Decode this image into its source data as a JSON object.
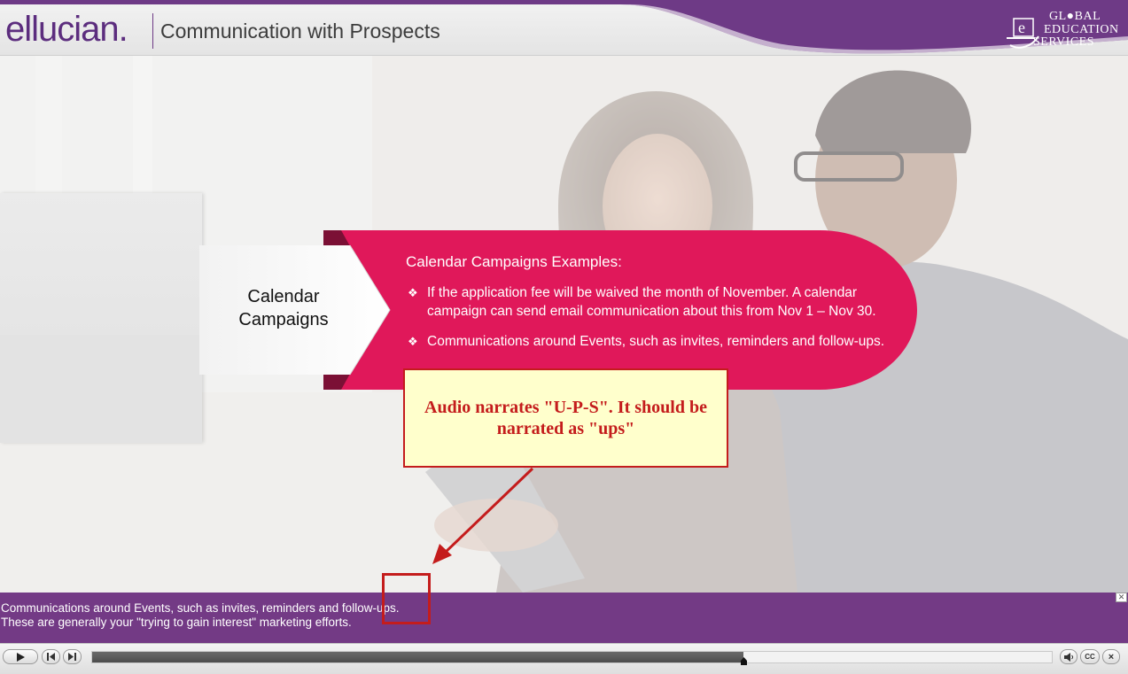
{
  "header": {
    "logo_text": "ellucian",
    "logo_dot": ".",
    "course_title": "Communication with Prospects",
    "brand_badge": {
      "line_1": "GL●BAL",
      "line_2": "EDUCATION",
      "line_3": "SERVICES",
      "emblem_letter": "e"
    }
  },
  "slide": {
    "callout_label": "Calendar Campaigns",
    "heading": "Calendar Campaigns Examples:",
    "bullets": [
      "If the application fee will be waived the month of November. A calendar campaign can send email communication about this from Nov 1 – Nov 30.",
      "Communications around Events, such as invites, reminders and follow-ups."
    ],
    "bullet_glyph": "❖"
  },
  "review_note": {
    "text": "Audio narrates \"U-P-S\". It should be narrated as \"ups\""
  },
  "captions": {
    "line_1": "Communications around Events, such as invites, reminders and follow-ups.",
    "line_2": "These are generally your \"trying to gain interest\" marketing efforts.",
    "close_glyph": "✕"
  },
  "player": {
    "progress": 0.679,
    "cc_label": "CC",
    "exit_glyph": "×"
  },
  "colors": {
    "brand_purple": "#733a85",
    "callout_magenta": "#e0185a",
    "note_red": "#c41c1c",
    "note_fill": "#ffffcc"
  }
}
